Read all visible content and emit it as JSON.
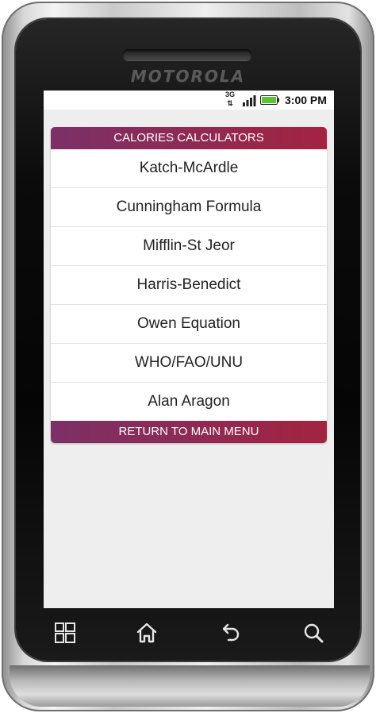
{
  "device": {
    "brand": "MOTOROLA"
  },
  "status_bar": {
    "network": "3G",
    "network_arrows": "⇅",
    "time": "3:00 PM",
    "battery_color": "#5ec436"
  },
  "menu": {
    "header": "CALORIES CALCULATORS",
    "items": [
      "Katch-McArdle",
      "Cunningham Formula",
      "Mifflin-St Jeor",
      "Harris-Benedict",
      "Owen Equation",
      "WHO/FAO/UNU",
      "Alan Aragon"
    ],
    "footer": "RETURN TO MAIN MENU",
    "accent_start": "#7b3067",
    "accent_end": "#a32340"
  },
  "nav": {
    "buttons": [
      "menu-icon",
      "home-icon",
      "back-icon",
      "search-icon"
    ]
  }
}
